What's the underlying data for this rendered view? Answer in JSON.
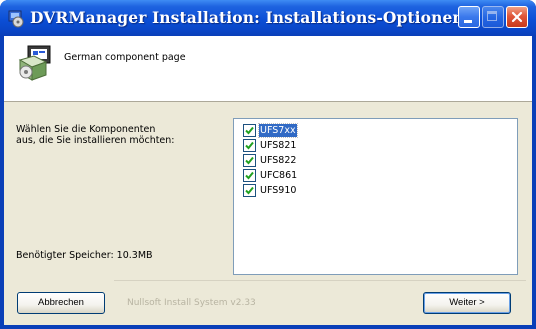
{
  "window": {
    "title": "DVRManager Installation: Installations-Optionen"
  },
  "header": {
    "text": "German component page"
  },
  "instructions": {
    "line1": "Wählen Sie die Komponenten",
    "line2": "aus, die Sie installieren möchten:"
  },
  "space_required": "Benötigter Speicher: 10.3MB",
  "components": [
    {
      "label": "UFS7xx",
      "checked": true,
      "selected": true
    },
    {
      "label": "UFS821",
      "checked": true,
      "selected": false
    },
    {
      "label": "UFS822",
      "checked": true,
      "selected": false
    },
    {
      "label": "UFC861",
      "checked": true,
      "selected": false
    },
    {
      "label": "UFS910",
      "checked": true,
      "selected": false
    }
  ],
  "branding": "Nullsoft Install System v2.33",
  "buttons": {
    "cancel": "Abbrechen",
    "next": "Weiter >"
  },
  "colors": {
    "titlebar": "#0b4fd6",
    "dialog": "#ece9d8",
    "selection": "#316ac5",
    "close": "#e0573a"
  }
}
